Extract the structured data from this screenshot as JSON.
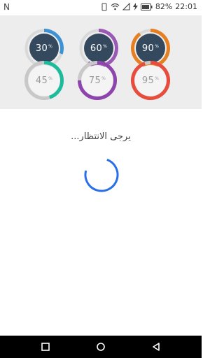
{
  "status_bar": {
    "left_glyph": "N",
    "battery": "82%",
    "time": "22:01",
    "icons": [
      "vibrate-icon",
      "wifi-icon",
      "signal-icon",
      "charging-icon",
      "battery-icon"
    ]
  },
  "gauges": [
    {
      "label": "30",
      "unit": "%",
      "progress": 0.3,
      "style": "dark",
      "color": "#3b93d6",
      "track": "#d9d9d9"
    },
    {
      "label": "60",
      "unit": "%",
      "progress": 0.6,
      "style": "dark",
      "color": "#9b59b6",
      "track": "#d9d9d9"
    },
    {
      "label": "90",
      "unit": "%",
      "progress": 0.9,
      "style": "dark",
      "color": "#e67e22",
      "track": "#d9d9d9"
    },
    {
      "label": "45",
      "unit": "%",
      "progress": 0.45,
      "style": "light",
      "color": "#1abc9c",
      "track": "#c8c8c8"
    },
    {
      "label": "75",
      "unit": "%",
      "progress": 0.75,
      "style": "light",
      "color": "#8e44ad",
      "track": "#c8c8c8"
    },
    {
      "label": "95",
      "unit": "%",
      "progress": 0.95,
      "style": "light",
      "color": "#e74c3c",
      "track": "#c8c8c8"
    }
  ],
  "loading": {
    "text": "يرجى الانتظار...",
    "spinner_color": "#2a6ee8"
  },
  "nav": {
    "icons": [
      "recents-square-icon",
      "home-circle-icon",
      "back-triangle-icon"
    ]
  },
  "colors": {
    "dark_circle": "#34495e",
    "light_circle": "#f4f4f4"
  }
}
